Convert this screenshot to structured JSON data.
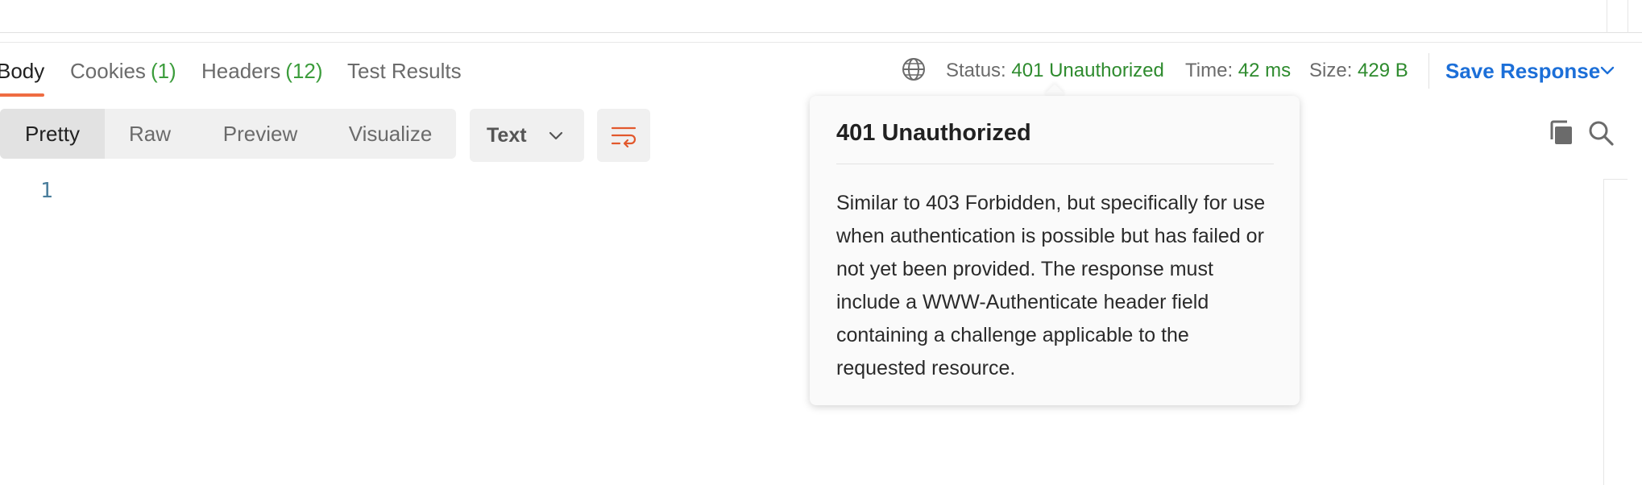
{
  "tabs": [
    {
      "label": "Body",
      "count": ""
    },
    {
      "label": "Cookies",
      "count": "(1)"
    },
    {
      "label": "Headers",
      "count": "(12)"
    },
    {
      "label": "Test Results",
      "count": ""
    }
  ],
  "status": {
    "status_label": "Status:",
    "status_value": "401 Unauthorized",
    "time_label": "Time:",
    "time_value": "42 ms",
    "size_label": "Size:",
    "size_value": "429 B",
    "globe_icon": "globe-icon"
  },
  "save_response": {
    "label": "Save Response",
    "icon": "chevron-down-icon"
  },
  "view_modes": [
    "Pretty",
    "Raw",
    "Preview",
    "Visualize"
  ],
  "format_select": {
    "selected": "Text",
    "icon": "chevron-down-icon"
  },
  "toolbar_icons": {
    "wrap": "wrap-lines-icon",
    "copy": "copy-icon",
    "search": "search-icon"
  },
  "editor": {
    "line_numbers": [
      "1"
    ]
  },
  "tooltip": {
    "title": "401 Unauthorized",
    "body": "Similar to 403 Forbidden, but specifically for use when authentication is possible but has failed or not yet been provided. The response must include a WWW-Authenticate header field containing a challenge applicable to the requested resource."
  },
  "colors": {
    "accent_orange": "#ef6c42",
    "status_green": "#2e8b2e",
    "link_blue": "#1c6fd8"
  }
}
